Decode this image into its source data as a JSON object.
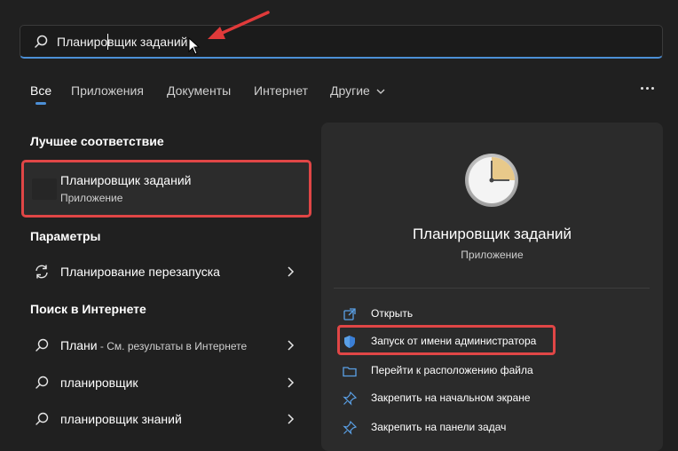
{
  "search": {
    "query": "Планировщик заданий"
  },
  "tabs": [
    {
      "label": "Все"
    },
    {
      "label": "Приложения"
    },
    {
      "label": "Документы"
    },
    {
      "label": "Интернет"
    },
    {
      "label": "Другие"
    }
  ],
  "best_match": {
    "title": "Лучшее соответствие",
    "name": "Планировщик заданий",
    "type": "Приложение"
  },
  "settings": {
    "title": "Параметры",
    "items": [
      {
        "label": "Планирование перезапуска",
        "icon": "refresh-icon"
      }
    ]
  },
  "web": {
    "title": "Поиск в Интернете",
    "items": [
      {
        "label": "Плани",
        "hint": " - См. результаты в Интернете",
        "icon": "search-icon"
      },
      {
        "label": "планировщик",
        "icon": "search-icon"
      },
      {
        "label": "планировщик знаний",
        "icon": "search-icon"
      }
    ]
  },
  "detail": {
    "name": "Планировщик заданий",
    "type": "Приложение",
    "icon": "clock-icon",
    "actions": [
      {
        "label": "Открыть",
        "icon": "open-icon"
      },
      {
        "label": "Запуск от имени администратора",
        "icon": "shield-icon"
      },
      {
        "label": "Перейти к расположению файла",
        "icon": "folder-icon"
      },
      {
        "label": "Закрепить на начальном экране",
        "icon": "pin-icon"
      },
      {
        "label": "Закрепить на панели задач",
        "icon": "pin-icon"
      }
    ]
  },
  "colors": {
    "accent": "#4c8fd6",
    "highlight": "#e04646",
    "background": "#202020",
    "panel": "#2b2b2b"
  }
}
